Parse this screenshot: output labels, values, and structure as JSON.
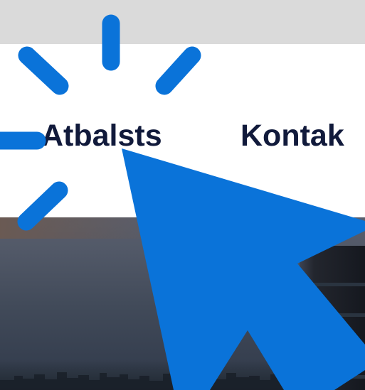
{
  "nav": {
    "items": [
      {
        "label": "Atbalsts"
      },
      {
        "label": "Kontak"
      }
    ]
  },
  "icons": {
    "click_burst": "click-burst-icon",
    "cursor": "mouse-pointer-icon"
  },
  "colors": {
    "top_bar": "#dadada",
    "nav_background": "#ffffff",
    "nav_text": "#111a3b",
    "accent_blue": "#0a73d9",
    "hero_sky_top": "#595e6d",
    "hero_sky_bottom": "#30394a"
  }
}
